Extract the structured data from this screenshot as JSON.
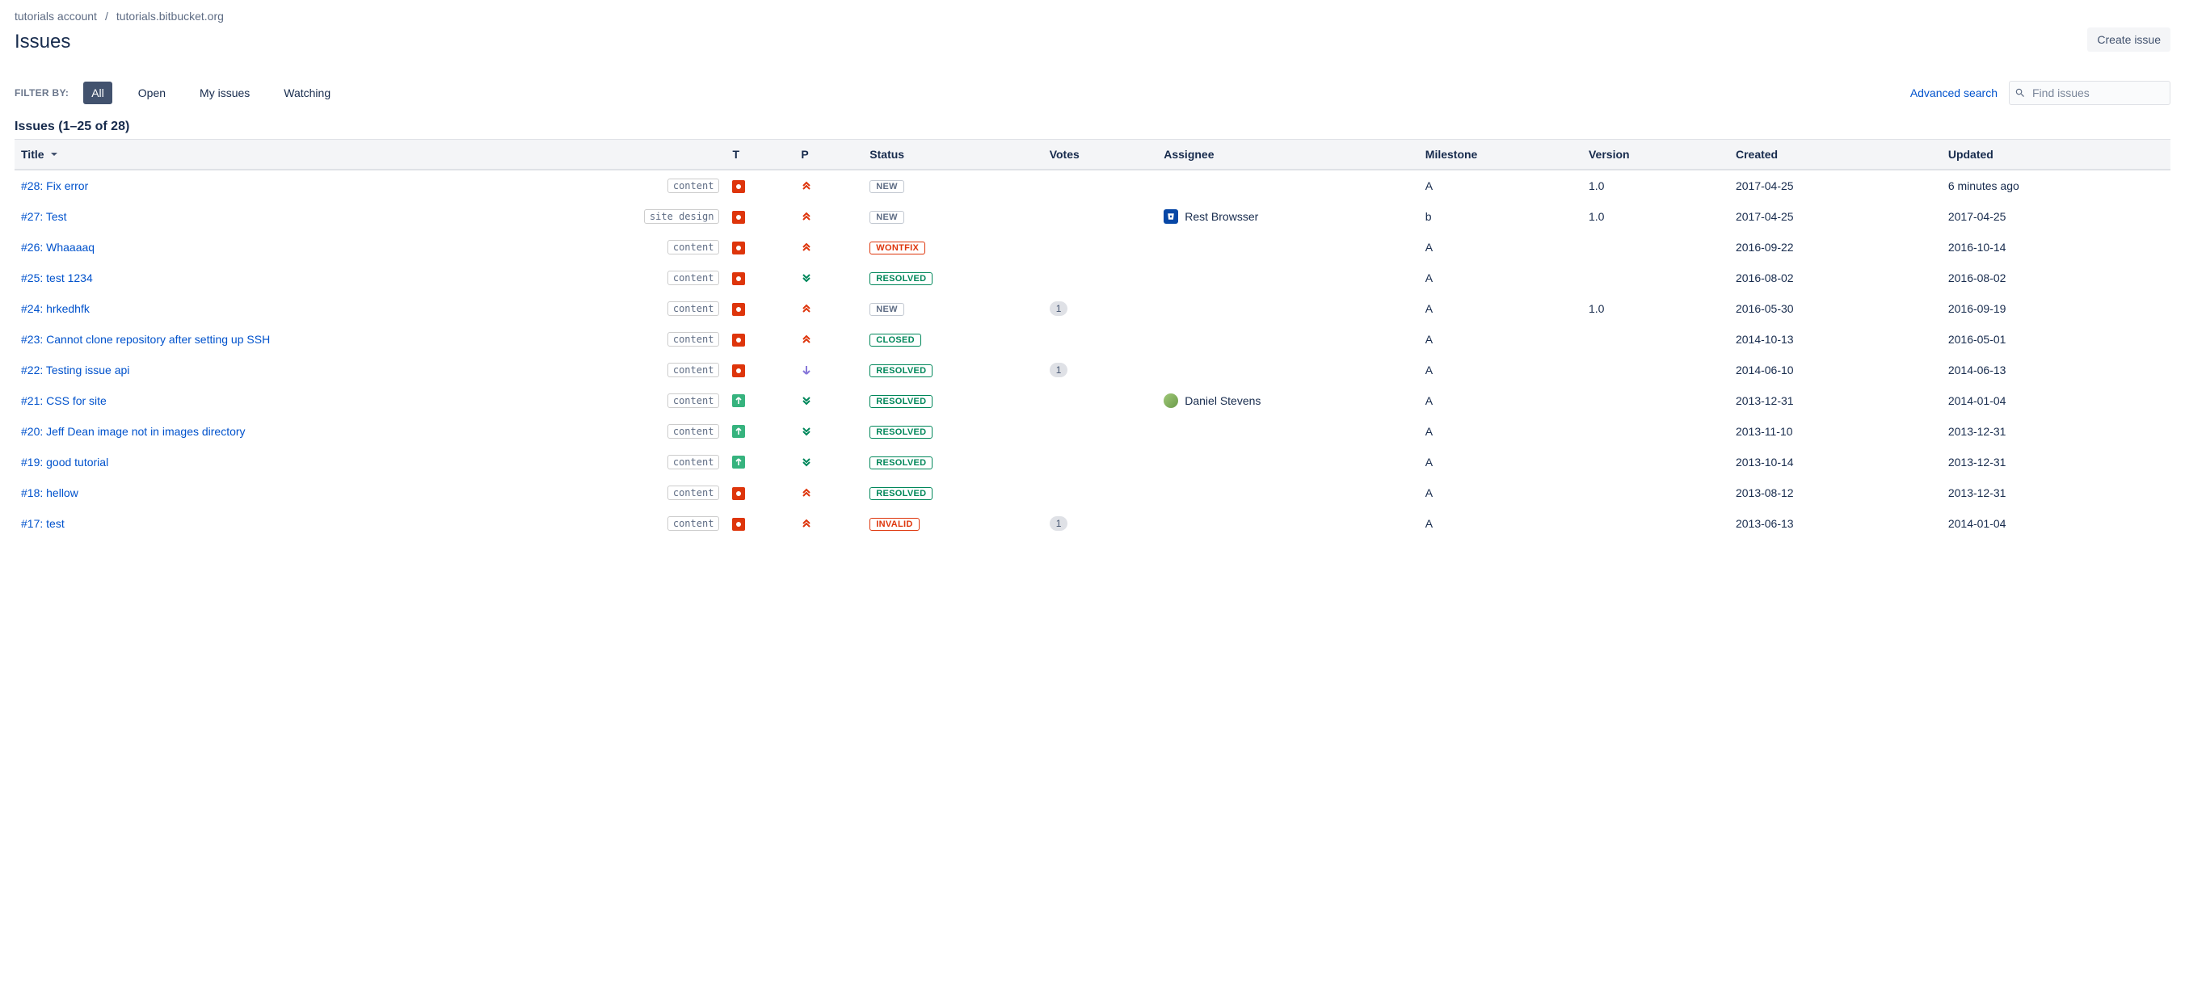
{
  "breadcrumbs": {
    "account": "tutorials account",
    "repo": "tutorials.bitbucket.org"
  },
  "pageTitle": "Issues",
  "createButton": "Create issue",
  "filter": {
    "label": "FILTER BY:",
    "tabs": [
      "All",
      "Open",
      "My issues",
      "Watching"
    ],
    "activeIndex": 0,
    "advancedSearch": "Advanced search",
    "searchPlaceholder": "Find issues"
  },
  "countHeading": "Issues (1–25 of 28)",
  "columns": {
    "title": "Title",
    "t": "T",
    "p": "P",
    "status": "Status",
    "votes": "Votes",
    "assignee": "Assignee",
    "milestone": "Milestone",
    "version": "Version",
    "created": "Created",
    "updated": "Updated"
  },
  "rows": [
    {
      "id": "#28",
      "title": "Fix error",
      "tag": "content",
      "type": "bug",
      "priority": "major",
      "status": "NEW",
      "statusClass": "new",
      "votes": "",
      "assignee": null,
      "milestone": "A",
      "version": "1.0",
      "created": "2017-04-25",
      "updated": "6 minutes ago"
    },
    {
      "id": "#27",
      "title": "Test",
      "tag": "site design",
      "type": "bug",
      "priority": "major",
      "status": "NEW",
      "statusClass": "new",
      "votes": "",
      "assignee": {
        "name": "Rest Browsser",
        "kind": "bitbucket"
      },
      "milestone": "b",
      "version": "1.0",
      "created": "2017-04-25",
      "updated": "2017-04-25"
    },
    {
      "id": "#26",
      "title": "Whaaaaq",
      "tag": "content",
      "type": "bug",
      "priority": "major",
      "status": "WONTFIX",
      "statusClass": "wontfix",
      "votes": "",
      "assignee": null,
      "milestone": "A",
      "version": "",
      "created": "2016-09-22",
      "updated": "2016-10-14"
    },
    {
      "id": "#25",
      "title": "test 1234",
      "tag": "content",
      "type": "bug",
      "priority": "trivial",
      "status": "RESOLVED",
      "statusClass": "resolved",
      "votes": "",
      "assignee": null,
      "milestone": "A",
      "version": "",
      "created": "2016-08-02",
      "updated": "2016-08-02"
    },
    {
      "id": "#24",
      "title": "hrkedhfk",
      "tag": "content",
      "type": "bug",
      "priority": "major",
      "status": "NEW",
      "statusClass": "new",
      "votes": "1",
      "assignee": null,
      "milestone": "A",
      "version": "1.0",
      "created": "2016-05-30",
      "updated": "2016-09-19"
    },
    {
      "id": "#23",
      "title": "Cannot clone repository after setting up SSH",
      "tag": "content",
      "type": "bug",
      "priority": "major",
      "status": "CLOSED",
      "statusClass": "closed",
      "votes": "",
      "assignee": null,
      "milestone": "A",
      "version": "",
      "created": "2014-10-13",
      "updated": "2016-05-01"
    },
    {
      "id": "#22",
      "title": "Testing issue api",
      "tag": "content",
      "type": "bug",
      "priority": "minor",
      "status": "RESOLVED",
      "statusClass": "resolved",
      "votes": "1",
      "assignee": null,
      "milestone": "A",
      "version": "",
      "created": "2014-06-10",
      "updated": "2014-06-13"
    },
    {
      "id": "#21",
      "title": "CSS for site",
      "tag": "content",
      "type": "improve",
      "priority": "trivial",
      "status": "RESOLVED",
      "statusClass": "resolved",
      "votes": "",
      "assignee": {
        "name": "Daniel Stevens",
        "kind": "user"
      },
      "milestone": "A",
      "version": "",
      "created": "2013-12-31",
      "updated": "2014-01-04"
    },
    {
      "id": "#20",
      "title": "Jeff Dean image not in images directory",
      "tag": "content",
      "type": "improve",
      "priority": "trivial",
      "status": "RESOLVED",
      "statusClass": "resolved",
      "votes": "",
      "assignee": null,
      "milestone": "A",
      "version": "",
      "created": "2013-11-10",
      "updated": "2013-12-31"
    },
    {
      "id": "#19",
      "title": "good tutorial",
      "tag": "content",
      "type": "improve",
      "priority": "trivial",
      "status": "RESOLVED",
      "statusClass": "resolved",
      "votes": "",
      "assignee": null,
      "milestone": "A",
      "version": "",
      "created": "2013-10-14",
      "updated": "2013-12-31"
    },
    {
      "id": "#18",
      "title": "hellow",
      "tag": "content",
      "type": "bug",
      "priority": "major",
      "status": "RESOLVED",
      "statusClass": "resolved",
      "votes": "",
      "assignee": null,
      "milestone": "A",
      "version": "",
      "created": "2013-08-12",
      "updated": "2013-12-31"
    },
    {
      "id": "#17",
      "title": "test",
      "tag": "content",
      "type": "bug",
      "priority": "major",
      "status": "INVALID",
      "statusClass": "invalid",
      "votes": "1",
      "assignee": null,
      "milestone": "A",
      "version": "",
      "created": "2013-06-13",
      "updated": "2014-01-04"
    }
  ]
}
